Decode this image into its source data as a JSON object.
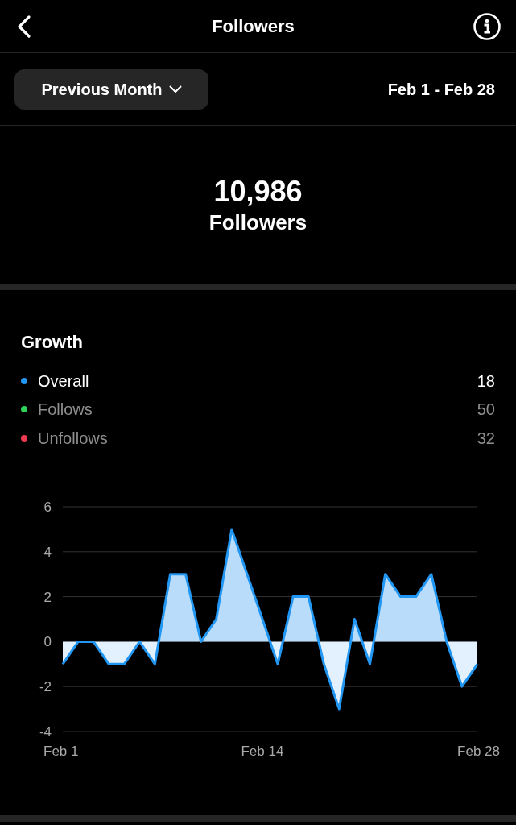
{
  "header": {
    "title": "Followers"
  },
  "filter": {
    "range_button": "Previous Month",
    "date_range": "Feb 1 - Feb 28"
  },
  "summary": {
    "count": "10,986",
    "label": "Followers"
  },
  "growth": {
    "title": "Growth",
    "legend": [
      {
        "label": "Overall",
        "value": "18",
        "color": "#2196f3",
        "selected": true
      },
      {
        "label": "Follows",
        "value": "50",
        "color": "#2fd158",
        "selected": false
      },
      {
        "label": "Unfollows",
        "value": "32",
        "color": "#ee3a4f",
        "selected": false
      }
    ],
    "chart_data": {
      "type": "area",
      "categories": [
        "Feb 1",
        null,
        null,
        null,
        null,
        null,
        null,
        null,
        null,
        null,
        null,
        null,
        null,
        "Feb 14",
        null,
        null,
        null,
        null,
        null,
        null,
        null,
        null,
        null,
        null,
        null,
        null,
        null,
        "Feb 28"
      ],
      "series": [
        {
          "color": "#2196f3",
          "values": [
            -1,
            0,
            0,
            -1,
            -1,
            0,
            -1,
            3,
            3,
            0,
            1,
            5,
            3,
            1,
            -1,
            2,
            2,
            -1,
            -3,
            1,
            -1,
            3,
            2,
            2,
            3,
            0,
            -2,
            -1
          ]
        }
      ],
      "grid": true,
      "ylim": [
        -4,
        6
      ],
      "yticks": [
        -4,
        -2,
        0,
        2,
        4,
        6
      ]
    }
  }
}
